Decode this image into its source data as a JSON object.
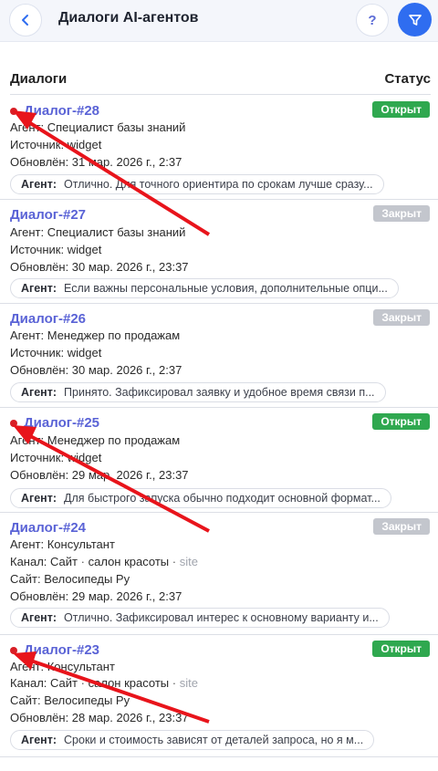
{
  "header": {
    "title": "Диалоги AI-агентов",
    "help_label": "?"
  },
  "list": {
    "col_dialogs": "Диалоги",
    "col_status": "Статус"
  },
  "dialogs": [
    {
      "title": "Диалог-#28",
      "status": "Открыт",
      "line1": "Агент: Специалист базы знаний",
      "line2": "Источник: widget",
      "updated": "Обновлён: 31 мар. 2026 г., 2:37",
      "preview_label": "Агент:",
      "preview_text": "Отлично. Для точного ориентира по срокам лучше сразу..."
    },
    {
      "title": "Диалог-#27",
      "status": "Закрыт",
      "line1": "Агент: Специалист базы знаний",
      "line2": "Источник: widget",
      "updated": "Обновлён: 30 мар. 2026 г., 23:37",
      "preview_label": "Агент:",
      "preview_text": "Если важны персональные условия, дополнительные опци..."
    },
    {
      "title": "Диалог-#26",
      "status": "Закрыт",
      "line1": "Агент: Менеджер по продажам",
      "line2": "Источник: widget",
      "updated": "Обновлён: 30 мар. 2026 г., 2:37",
      "preview_label": "Агент:",
      "preview_text": "Принято. Зафиксировал заявку и удобное время связи п..."
    },
    {
      "title": "Диалог-#25",
      "status": "Открыт",
      "line1": "Агент: Менеджер по продажам",
      "line2": "Источник: widget",
      "updated": "Обновлён: 29 мар. 2026 г., 23:37",
      "preview_label": "Агент:",
      "preview_text": "Для быстрого запуска обычно подходит основной формат..."
    },
    {
      "title": "Диалог-#24",
      "status": "Закрыт",
      "line1": "Агент: Консультант",
      "channel_label": "Канал: Сайт",
      "channel_dot": "·",
      "channel_name": "салон красоты",
      "channel_type": "site",
      "site": "Сайт: Велосипеды Ру",
      "updated": "Обновлён: 29 мар. 2026 г., 2:37",
      "preview_label": "Агент:",
      "preview_text": "Отлично. Зафиксировал интерес к основному варианту и..."
    },
    {
      "title": "Диалог-#23",
      "status": "Открыт",
      "line1": "Агент: Консультант",
      "channel_label": "Канал: Сайт",
      "channel_dot": "·",
      "channel_name": "салон красоты",
      "channel_type": "site",
      "site": "Сайт: Велосипеды Ру",
      "updated": "Обновлён: 28 мар. 2026 г., 23:37",
      "preview_label": "Агент:",
      "preview_text": "Сроки и стоимость зависят от деталей запроса, но я м..."
    }
  ],
  "colors": {
    "accent": "#2f6df0",
    "title": "#5a63d6",
    "open": "#2fa84f",
    "closed": "#c3c6cd",
    "unread_dot": "#d81f26",
    "annotation_arrow": "#e8141b"
  },
  "icons": {
    "back": "chevron-left-icon",
    "help": "question-icon",
    "filter": "filter-icon",
    "unread": "unread-dot-icon"
  }
}
